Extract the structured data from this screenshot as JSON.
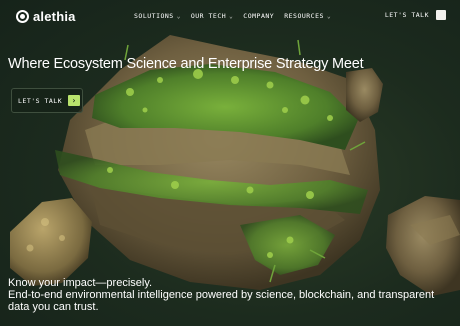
{
  "brand": {
    "name": "alethia",
    "logo_icon": "ring-logo-icon"
  },
  "nav": {
    "items": [
      {
        "label": "SOLUTIONS",
        "has_dropdown": true
      },
      {
        "label": "OUR TECH",
        "has_dropdown": true
      },
      {
        "label": "COMPANY",
        "has_dropdown": false
      },
      {
        "label": "RESOURCES",
        "has_dropdown": true
      }
    ],
    "cta_label": "LET'S TALK",
    "dropdown_icon": "chevron-down-icon"
  },
  "hero": {
    "headline": "Where Ecosystem Science and Enterprise Strategy Meet",
    "button_label": "LET'S TALK",
    "button_icon": "arrow-right-icon",
    "tagline_line1": "Know your impact—precisely.",
    "tagline_line2": "End-to-end environmental intelligence powered by science, blockchain, and transparent data you can trust."
  },
  "colors": {
    "background": "#1b2a1e",
    "accent": "#b9e36d",
    "text": "#ffffff"
  }
}
